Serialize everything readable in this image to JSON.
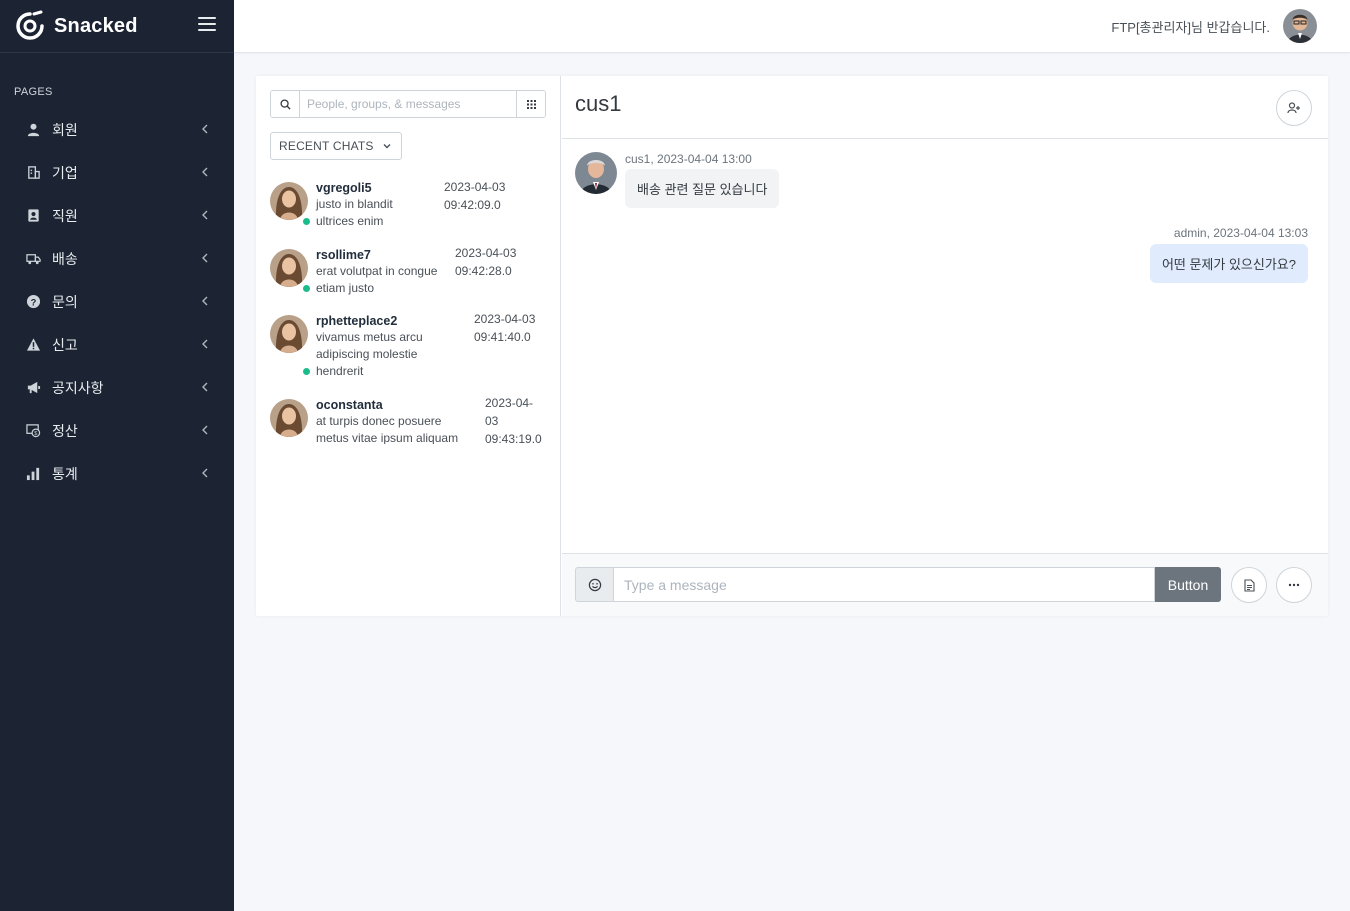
{
  "brand": {
    "name": "Snacked"
  },
  "sidebar": {
    "section_header": "PAGES",
    "items": [
      {
        "label": "회원",
        "icon": "user-icon"
      },
      {
        "label": "기업",
        "icon": "building-icon"
      },
      {
        "label": "직원",
        "icon": "id-badge-icon"
      },
      {
        "label": "배송",
        "icon": "truck-icon"
      },
      {
        "label": "문의",
        "icon": "question-circle-icon"
      },
      {
        "label": "신고",
        "icon": "warning-icon"
      },
      {
        "label": "공지사항",
        "icon": "megaphone-icon"
      },
      {
        "label": "정산",
        "icon": "settlement-icon"
      },
      {
        "label": "통계",
        "icon": "bar-chart-icon"
      }
    ]
  },
  "topbar": {
    "greeting": "FTP[총관리자]님 반갑습니다."
  },
  "search": {
    "placeholder": "People, groups, & messages"
  },
  "recent_chats_label": "RECENT CHATS",
  "chats": [
    {
      "name": "vgregoli5",
      "lines": [
        "justo in blandit",
        "ultrices enim"
      ],
      "time_lines": [
        "2023-04-03",
        "09:42:09.0"
      ]
    },
    {
      "name": "rsollime7",
      "lines": [
        "erat volutpat in congue",
        "etiam justo"
      ],
      "time_lines": [
        "2023-04-03",
        "09:42:28.0"
      ]
    },
    {
      "name": "rphetteplace2",
      "lines": [
        "vivamus metus arcu",
        "adipiscing molestie",
        "hendrerit"
      ],
      "time_lines": [
        "2023-04-03",
        "09:41:40.0"
      ]
    },
    {
      "name": "oconstanta",
      "lines": [
        "at turpis donec posuere",
        "metus vitae ipsum aliquam"
      ],
      "time_lines": [
        "2023-04-",
        "03",
        "09:43:19.0"
      ]
    }
  ],
  "conversation": {
    "title": "cus1",
    "messages": [
      {
        "meta": "cus1, 2023-04-04 13:00",
        "text": "배송 관련 질문 있습니다"
      },
      {
        "meta": "admin, 2023-04-04 13:03",
        "text": "어떤 문제가 있으신가요?"
      }
    ]
  },
  "composer": {
    "placeholder": "Type a message",
    "send_label": "Button"
  },
  "colors": {
    "sidebar_bg": "#1c2434",
    "accent_online": "#1cbb8c",
    "my_bubble": "#e0ecfd",
    "send_button": "#6c757d"
  }
}
